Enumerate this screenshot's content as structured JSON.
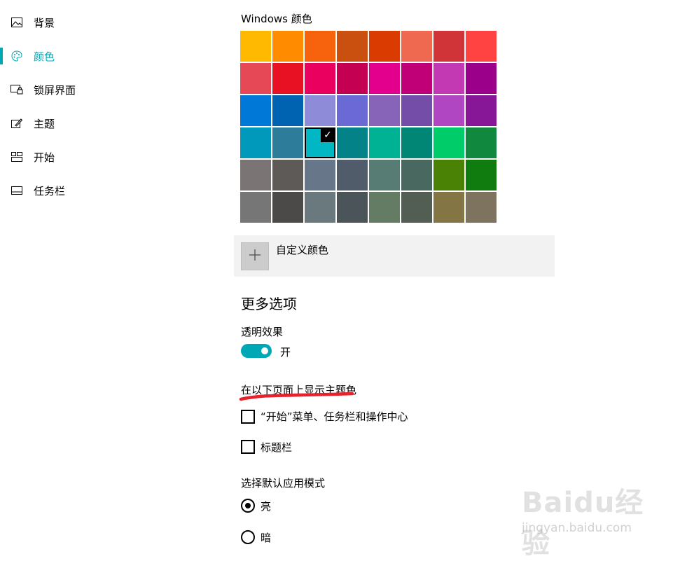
{
  "sidebar": {
    "items": [
      {
        "label": "背景",
        "icon": "picture-icon"
      },
      {
        "label": "颜色",
        "icon": "palette-icon",
        "active": true
      },
      {
        "label": "锁屏界面",
        "icon": "lock-screen-icon"
      },
      {
        "label": "主题",
        "icon": "theme-icon"
      },
      {
        "label": "开始",
        "icon": "start-icon"
      },
      {
        "label": "任务栏",
        "icon": "taskbar-icon"
      }
    ]
  },
  "accent": "#00a7b4",
  "windows_colors": {
    "title": "Windows 颜色",
    "swatches": [
      "#ffb900",
      "#ff8c00",
      "#f7630c",
      "#ca5010",
      "#da3b01",
      "#ef6950",
      "#d13438",
      "#ff4343",
      "#e74856",
      "#e81123",
      "#ea005e",
      "#c30052",
      "#e3008c",
      "#bf0077",
      "#c239b3",
      "#9a0089",
      "#0078d7",
      "#0063b1",
      "#8e8cd8",
      "#6b69d6",
      "#8764b8",
      "#744da9",
      "#b146c2",
      "#881798",
      "#0099bc",
      "#2d7d9a",
      "#00b7c3",
      "#038387",
      "#00b294",
      "#018574",
      "#00cc6a",
      "#10893e",
      "#7a7574",
      "#5d5a58",
      "#68768a",
      "#515c6b",
      "#567c73",
      "#486860",
      "#498205",
      "#107c10",
      "#767676",
      "#4c4a48",
      "#69797e",
      "#4a5459",
      "#647c64",
      "#525e54",
      "#847545",
      "#7e735f"
    ],
    "selected_index": 26,
    "check_glyph": "✓"
  },
  "custom_color": {
    "label": "自定义颜色",
    "icon": "plus-icon"
  },
  "more_options": {
    "heading": "更多选项",
    "transparency": {
      "label": "透明效果",
      "state_label": "开",
      "on": true
    },
    "show_accent": {
      "label": "在以下页面上显示主题色",
      "options": [
        {
          "label": "“开始”菜单、任务栏和操作中心",
          "checked": false
        },
        {
          "label": "标题栏",
          "checked": false
        }
      ]
    },
    "app_mode": {
      "label": "选择默认应用模式",
      "options": [
        {
          "label": "亮",
          "selected": true
        },
        {
          "label": "暗",
          "selected": false
        }
      ]
    }
  },
  "watermark": {
    "brand": "Baidu经验",
    "url": "jingyan.baidu.com"
  }
}
